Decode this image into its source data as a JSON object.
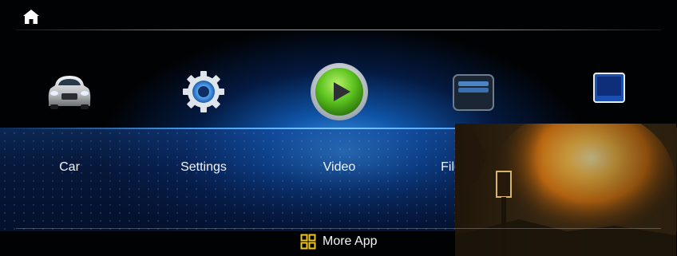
{
  "apps": {
    "car": "Car",
    "settings": "Settings",
    "video": "Video",
    "file": "File"
  },
  "bottom": {
    "more_app": "More App"
  },
  "icons": {
    "home": "home-icon",
    "car": "car-icon",
    "settings": "gear-icon",
    "video": "play-icon",
    "file": "folder-icon",
    "other": "tablet-icon",
    "more_app": "grid-icon"
  },
  "colors": {
    "accent_glow": "#2f8cf0",
    "video_green": "#5cc31f",
    "more_app_icon": "#f0c419"
  }
}
